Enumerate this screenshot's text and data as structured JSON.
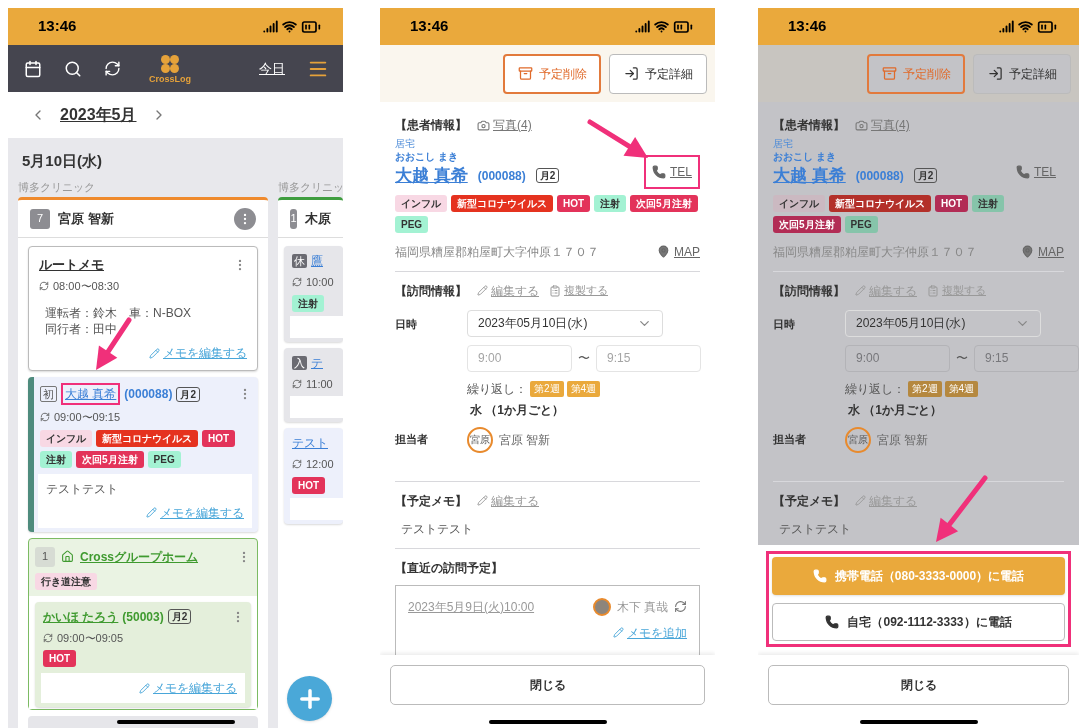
{
  "left_phone": {
    "status_bar": {
      "time": "13:46"
    },
    "toolbar": {
      "logo_text": "CrossLog",
      "today_link": "今日"
    },
    "month": "2023年5月",
    "date": "5月10日(水)",
    "columns": [
      {
        "clinic": "博多クリニック",
        "color": "#ef8a2d",
        "count": "7",
        "staff": "宮原 智新",
        "items": [
          {
            "kind": "memo",
            "title": "ルートメモ",
            "time": "08:00〜08:30",
            "lines": [
              "運転者：鈴木　車：N-BOX",
              "同行者：田中"
            ],
            "link": "メモを編集する"
          },
          {
            "kind": "visit",
            "color": "#edf0fb",
            "badge": "初",
            "name": "大越 真希",
            "code": "(000088)",
            "freq": "月2",
            "time": "09:00〜09:15",
            "highlighted": true,
            "tags": [
              {
                "label": "インフル",
                "color": "#f8d8e4"
              },
              {
                "label": "新型コロナウイルス",
                "color": "#e5321f"
              },
              {
                "label": "HOT",
                "color": "#e3335a"
              },
              {
                "label": "注射",
                "color": "#a3f2d3"
              },
              {
                "label": "次回5月注射",
                "color": "#e3335a"
              },
              {
                "label": "PEG",
                "color": "#a3f2d3"
              }
            ],
            "note": "テストテスト",
            "link": "メモを編集する"
          },
          {
            "kind": "group",
            "count": "1",
            "name": "Crossグループホーム",
            "tags": [
              {
                "label": "行き道注意",
                "color": "#f8d8e4"
              }
            ],
            "members": [
              {
                "kind": "visit",
                "color": "#e4efdb",
                "name": "かいほ たろう",
                "code": "(50003)",
                "freq": "月2",
                "time": "09:00〜09:05",
                "highlighted": false,
                "tags": [
                  {
                    "label": "HOT",
                    "color": "#e3335a"
                  }
                ],
                "link": "メモを編集する"
              }
            ]
          }
        ]
      },
      {
        "clinic": "博多クリニッ",
        "color": "#3f9d3f",
        "count": "1",
        "staff": "木原",
        "items": [
          {
            "kind": "visit",
            "color": "#e6e6ea",
            "badge": "休",
            "name": "鷹",
            "time": "10:00",
            "highlighted": false,
            "tags": [
              {
                "label": "注射",
                "color": "#a3f2d3"
              }
            ]
          },
          {
            "kind": "visit",
            "color": "#e6e6ea",
            "badge": "入",
            "name": "テ",
            "time": "11:00",
            "highlighted": false
          },
          {
            "kind": "visit",
            "color": "#edf0fb",
            "name": "テスト",
            "time": "12:00",
            "highlighted": false,
            "tags": [
              {
                "label": "HOT",
                "color": "#e3335a"
              }
            ]
          }
        ]
      }
    ]
  },
  "detail_screens": [
    {
      "status_bar": {
        "time": "13:46"
      },
      "dimmed": false,
      "actions": [
        {
          "kind": "delete",
          "label": "予定削除"
        },
        {
          "kind": "detail",
          "label": "予定詳細"
        }
      ],
      "patient": {
        "heading": "【患者情報】",
        "photo_link": "写真(4)",
        "category": "居宅",
        "kana": "おおこし まき",
        "name": "大越 真希",
        "code": "(000088)",
        "freq": "月2",
        "tel_link": "TEL",
        "tel_highlighted": true,
        "tags": [
          {
            "label": "インフル",
            "color": "#f8d8e4"
          },
          {
            "label": "新型コロナウイルス",
            "color": "#e5321f"
          },
          {
            "label": "HOT",
            "color": "#e3335a"
          },
          {
            "label": "注射",
            "color": "#a3f2d3"
          },
          {
            "label": "次回5月注射",
            "color": "#e3335a"
          },
          {
            "label": "PEG",
            "color": "#a3f2d3"
          }
        ],
        "address": "福岡県糟屋郡粕屋町大字仲原１７０７",
        "map_link": "MAP"
      },
      "visit": {
        "heading": "【訪問情報】",
        "edit_link": "編集する",
        "copy_link": "複製する",
        "date_label": "日時",
        "date_value": "2023年05月10日(水)",
        "start_placeholder": "9:00",
        "separator": "〜",
        "end_placeholder": "9:15",
        "repeat_label": "繰り返し：",
        "weeks": [
          "第2週",
          "第4週"
        ],
        "repeat_text": "水 （1か月ごと）",
        "staff_label": "担当者",
        "staff_avatar": "宮原",
        "staff_name": "宮原 智新"
      },
      "memo": {
        "heading": "【予定メモ】",
        "edit_link": "編集する",
        "text": "テストテスト"
      },
      "upcoming": {
        "heading": "【直近の訪問予定】",
        "date_link": "2023年5月9日(火)10:00",
        "staff_name": "木下 真哉",
        "add_memo_link": "メモを追加"
      },
      "close_button": "閉じる"
    },
    {
      "status_bar": {
        "time": "13:46"
      },
      "dimmed": true,
      "actions": [
        {
          "kind": "delete",
          "label": "予定削除"
        },
        {
          "kind": "detail",
          "label": "予定詳細"
        }
      ],
      "patient": {
        "heading": "【患者情報】",
        "photo_link": "写真(4)",
        "category": "居宅",
        "kana": "おおこし まき",
        "name": "大越 真希",
        "code": "(000088)",
        "freq": "月2",
        "tel_link": "TEL",
        "tel_highlighted": false,
        "tags": [
          {
            "label": "インフル",
            "color": "#cbb9c1"
          },
          {
            "label": "新型コロナウイルス",
            "color": "#b3302a"
          },
          {
            "label": "HOT",
            "color": "#b22c55"
          },
          {
            "label": "注射",
            "color": "#86c4aa"
          },
          {
            "label": "次回5月注射",
            "color": "#b22c55"
          },
          {
            "label": "PEG",
            "color": "#86c4aa"
          }
        ],
        "address": "福岡県糟屋郡粕屋町大字仲原１７０７",
        "map_link": "MAP"
      },
      "visit": {
        "heading": "【訪問情報】",
        "edit_link": "編集する",
        "copy_link": "複製する",
        "date_label": "日時",
        "date_value": "2023年05月10日(水)",
        "start_placeholder": "9:00",
        "separator": "〜",
        "end_placeholder": "9:15",
        "repeat_label": "繰り返し：",
        "weeks": [
          "第2週",
          "第4週"
        ],
        "repeat_text": "水 （1か月ごと）",
        "staff_label": "担当者",
        "staff_avatar": "宮原",
        "staff_name": "宮原 智新"
      },
      "memo": {
        "heading": "【予定メモ】",
        "edit_link": "編集する",
        "text": "テストテスト"
      },
      "call_sheet": {
        "highlighted": true,
        "buttons": [
          {
            "label": "携帯電話（080-3333-0000）に電話",
            "primary": true
          },
          {
            "label": "自宅（092-1112-3333）に電話",
            "primary": false
          }
        ]
      },
      "close_button": "閉じる"
    }
  ]
}
